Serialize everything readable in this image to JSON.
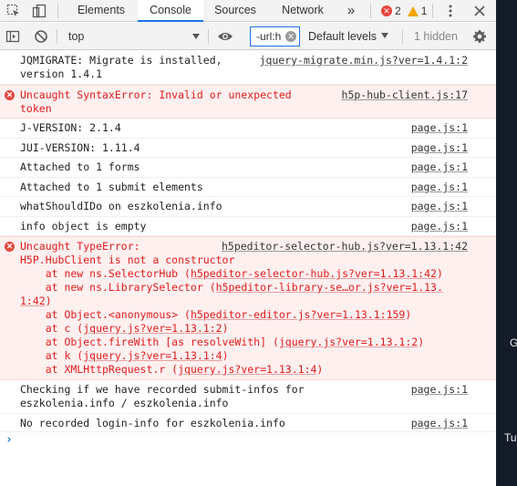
{
  "tabs": {
    "items": [
      "Elements",
      "Console",
      "Sources",
      "Network"
    ],
    "more": "»",
    "error_count": "2",
    "warning_count": "1",
    "error_icon": "x-circle-icon",
    "warning_icon": "warning-triangle-icon"
  },
  "toolbar": {
    "context": "top",
    "filter_value": "-url:h",
    "levels": "Default levels",
    "hidden": "1 hidden"
  },
  "colors": {
    "accent": "#1a73e8",
    "error_text": "#e21b1b",
    "error_bg": "#fff0f0",
    "error_dot": "#e8453c",
    "warning": "#f2a600",
    "right_strip": "#141c2a"
  },
  "console": {
    "messages": [
      {
        "text": "JQMIGRATE: Migrate is installed,\nversion 1.4.1",
        "source": "jquery-migrate.min.js?ver=1.4.1:2"
      },
      {
        "text": "Uncaught SyntaxError: Invalid or unexpected\ntoken",
        "source": "h5p-hub-client.js:17"
      },
      {
        "text": "J-VERSION: 2.1.4",
        "source": "page.js:1"
      },
      {
        "text": "JUI-VERSION: 1.11.4",
        "source": "page.js:1"
      },
      {
        "text": "Attached to 1 forms",
        "source": "page.js:1"
      },
      {
        "text": "Attached to 1 submit elements",
        "source": "page.js:1"
      },
      {
        "text": "whatShouldIDo on eszkolenia.info",
        "source": "page.js:1"
      },
      {
        "text": "info object is empty",
        "source": "page.js:1"
      },
      {
        "text": "Uncaught TypeError:",
        "source": "h5peditor-selector-hub.js?ver=1.13.1:42"
      },
      {
        "text": "Checking if we have recorded submit-infos for\neszkolenia.info / eszkolenia.info",
        "source": "page.js:1"
      },
      {
        "text": "No recorded login-info for eszkolenia.info",
        "source": "page.js:1"
      }
    ],
    "type_error": {
      "summary": "H5P.HubClient is not a constructor",
      "stack": [
        {
          "pre": "    at new ns.SelectorHub (",
          "link": "h5peditor-selector-hub.js?ver=1.13.1:42",
          "post": ")"
        },
        {
          "pre": "    at new ns.LibrarySelector (",
          "link": "h5peditor-library-se…or.js?ver=1.13.",
          "post": ""
        },
        {
          "pre": "",
          "link": "1:42",
          "post": ")"
        },
        {
          "pre": "    at Object.<anonymous> (",
          "link": "h5peditor-editor.js?ver=1.13.1:159",
          "post": ")"
        },
        {
          "pre": "    at c (",
          "link": "jquery.js?ver=1.13.1:2",
          "post": ")"
        },
        {
          "pre": "    at Object.fireWith [as resolveWith] (",
          "link": "jquery.js?ver=1.13.1:2",
          "post": ")"
        },
        {
          "pre": "    at k (",
          "link": "jquery.js?ver=1.13.1:4",
          "post": ")"
        },
        {
          "pre": "    at XMLHttpRequest.r (",
          "link": "jquery.js?ver=1.13.1:4",
          "post": ")"
        }
      ]
    },
    "prompt": "›"
  },
  "background": {
    "letter_g": "G",
    "letter_tu": "Tu"
  }
}
